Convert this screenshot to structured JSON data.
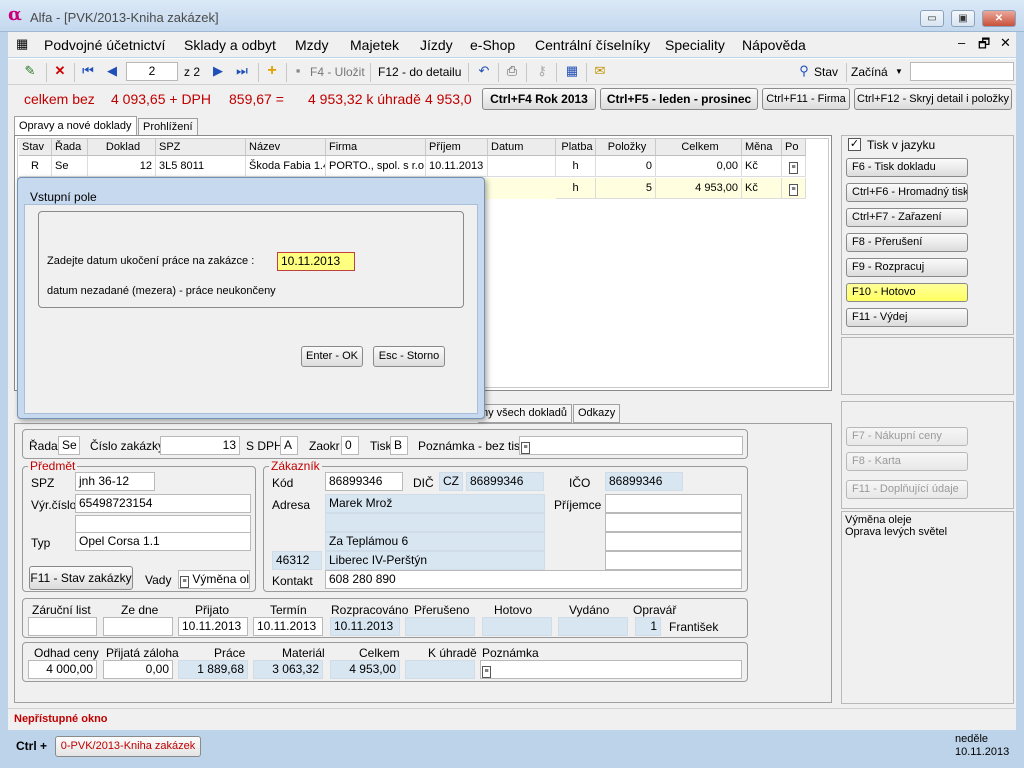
{
  "window": {
    "app_symbol": "α",
    "title": "Alfa - [PVK/2013-Kniha zakázek]",
    "minimize": "▭",
    "restore": "▣",
    "close": "✕"
  },
  "menu": [
    "Podvojné účetnictví",
    "Sklady a odbyt",
    "Mzdy",
    "Majetek",
    "Jízdy",
    "e-Shop",
    "Centrální číselníky",
    "Speciality",
    "Nápověda"
  ],
  "mdi": {
    "min": "–",
    "restore": "🗗",
    "close": "✕"
  },
  "toolbar": {
    "page": "2",
    "of": "z 2",
    "save": "F4 - Uložit",
    "detail": "F12 - do detailu",
    "stav": "Stav",
    "mode": "Začíná"
  },
  "stats": {
    "total_label": "celkem bez",
    "total_value": "4 093,65 + DPH",
    "dph_value": "859,67 =",
    "to_pay": "4 953,32 k úhradě",
    "to_pay2": "4 953,0",
    "btn1": "Ctrl+F4 Rok 2013",
    "btn2": "Ctrl+F5 - leden - prosinec",
    "btn3": "Ctrl+F11 - Firma",
    "btn4": "Ctrl+F12 - Skryj detail i položky"
  },
  "tabs_top": [
    "Opravy a nové doklady",
    "Prohlížení"
  ],
  "grid": {
    "headers": [
      "Stav",
      "Řada",
      "Doklad",
      "SPZ",
      "Název",
      "Firma",
      "Příjem",
      "Datum",
      "Platba",
      "Položky",
      "Celkem",
      "Měna",
      "Po"
    ],
    "rows": [
      [
        "R",
        "Se",
        "12",
        "3L5 8011",
        "Škoda Fabia 1.4",
        "PORTO., spol. s r.o.",
        "10.11.2013",
        "",
        "h",
        "0",
        "0,00",
        "Kč"
      ],
      [
        "",
        "",
        "",
        "",
        "",
        "",
        "",
        "",
        "h",
        "5",
        "4 953,00",
        "Kč"
      ]
    ]
  },
  "right_panel": {
    "checkbox_label": "Tisk v jazyku",
    "checkbox_checked": "✓",
    "buttons": [
      "F6 - Tisk dokladu",
      "Ctrl+F6 - Hromadný tisk",
      "Ctrl+F7 - Zařazení",
      "F8 - Přerušení",
      "F9 - Rozpracuj",
      "F10 - Hotovo",
      "F11 - Výdej"
    ],
    "disabled_buttons": [
      "F7 - Nákupní ceny",
      "F8 - Karta",
      "F11 - Doplňující údaje"
    ],
    "notes": [
      "Výměna oleje",
      "Oprava levých světel"
    ]
  },
  "tabs_bottom": [
    "ny všech dokladů",
    "Odkazy"
  ],
  "detail": {
    "rada_label": "Řada",
    "rada": "Se",
    "cislo_label": "Číslo zakázky",
    "cislo": "13",
    "sdph_label": "S DPH",
    "sdph": "A",
    "zaokr_label": "Zaokr",
    "zaokr": "0",
    "tisk_label": "Tisk",
    "tisk": "B",
    "poznamka_label": "Poznámka - bez tisku"
  },
  "predmet": {
    "title": "Předmět",
    "spz_label": "SPZ",
    "spz": "jnh 36-12",
    "vyr_label": "Výr.číslo",
    "vyr": "65498723154",
    "typ_label": "Typ",
    "typ": "Opel Corsa 1.1",
    "stav_btn": "F11 - Stav zakázky",
    "vady_label": "Vady",
    "vady": "Výměna ole"
  },
  "zakaznik": {
    "title": "Zákazník",
    "kod_label": "Kód",
    "kod": "86899346",
    "dic_label": "DIČ",
    "dic_prefix": "CZ",
    "dic": "86899346",
    "ico_label": "IČO",
    "ico": "86899346",
    "adresa_label": "Adresa",
    "name": "Marek Mrož",
    "street": "Za Teplámou 6",
    "psc": "46312",
    "city": "Liberec IV-Perštýn",
    "kontakt_label": "Kontakt",
    "kontakt": "608 280 890",
    "prijemce_label": "Příjemce"
  },
  "dates": {
    "labels": [
      "Záruční list",
      "Ze dne",
      "Přijato",
      "Termín",
      "Rozpracováno",
      "Přerušeno",
      "Hotovo",
      "Vydáno",
      "Opravář"
    ],
    "prijato": "10.11.2013",
    "termin": "10.11.2013",
    "rozpracovano": "10.11.2013",
    "opravar_num": "1",
    "opravar": "František"
  },
  "totals": {
    "labels": [
      "Odhad ceny",
      "Přijatá záloha",
      "Práce",
      "Materiál",
      "Celkem",
      "K úhradě",
      "Poznámka"
    ],
    "odhad": "4 000,00",
    "zaloha": "0,00",
    "prace": "1 889,68",
    "material": "3 063,32",
    "celkem": "4 953,00"
  },
  "dialog": {
    "title": "Vstupní pole",
    "prompt": "Zadejte datum ukočení práce na zakázce :",
    "value": "10.11.2013",
    "hint": "datum nezadané (mezera) - práce neukončeny",
    "ok": "Enter - OK",
    "cancel": "Esc - Storno"
  },
  "status": {
    "text": "Nepřístupné okno"
  },
  "taskbar": {
    "ctrl": "Ctrl +",
    "item": "0-PVK/2013-Kniha zakázek",
    "day": "neděle",
    "date": "10.11.2013"
  },
  "colors": {
    "accent_red": "#c00000",
    "highlight_yellow": "#ffff80",
    "selected_row": "#ffffe0",
    "readonly_blue": "#d8e6f2"
  }
}
